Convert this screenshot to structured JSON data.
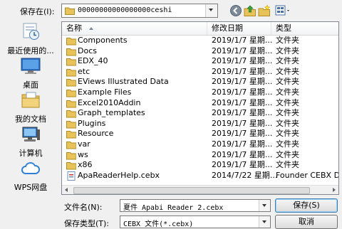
{
  "location": {
    "label": "保存在(I):",
    "path": "00000000000000000ceshi"
  },
  "toolbar": {
    "back_icon": "back-arrow-icon",
    "up_icon": "up-folder-icon",
    "new_folder_icon": "new-folder-icon",
    "views_icon": "view-menu-icon"
  },
  "places": [
    {
      "label": "最近使用的...",
      "icon": "recent-icon"
    },
    {
      "label": "桌面",
      "icon": "desktop-icon"
    },
    {
      "label": "我的文档",
      "icon": "documents-icon"
    },
    {
      "label": "计算机",
      "icon": "computer-icon"
    },
    {
      "label": "WPS网盘",
      "icon": "cloud-icon"
    }
  ],
  "columns": {
    "name": "名称",
    "date": "修改日期",
    "type": "类型"
  },
  "files": [
    {
      "name": "Components",
      "date": "2019/1/7 星期...",
      "type": "文件夹",
      "icon": "folder-icon"
    },
    {
      "name": "Docs",
      "date": "2019/1/7 星期...",
      "type": "文件夹",
      "icon": "folder-icon"
    },
    {
      "name": "EDX_40",
      "date": "2019/1/7 星期...",
      "type": "文件夹",
      "icon": "folder-icon"
    },
    {
      "name": "etc",
      "date": "2019/1/7 星期...",
      "type": "文件夹",
      "icon": "folder-icon"
    },
    {
      "name": "EViews Illustrated Data",
      "date": "2019/1/7 星期...",
      "type": "文件夹",
      "icon": "folder-icon"
    },
    {
      "name": "Example Files",
      "date": "2019/1/7 星期...",
      "type": "文件夹",
      "icon": "folder-icon"
    },
    {
      "name": "Excel2010Addin",
      "date": "2019/1/7 星期...",
      "type": "文件夹",
      "icon": "folder-icon"
    },
    {
      "name": "Graph_templates",
      "date": "2019/1/7 星期...",
      "type": "文件夹",
      "icon": "folder-icon"
    },
    {
      "name": "Plugins",
      "date": "2019/1/7 星期...",
      "type": "文件夹",
      "icon": "folder-icon"
    },
    {
      "name": "Resource",
      "date": "2019/1/7 星期...",
      "type": "文件夹",
      "icon": "folder-icon"
    },
    {
      "name": "var",
      "date": "2019/1/7 星期...",
      "type": "文件夹",
      "icon": "folder-icon"
    },
    {
      "name": "ws",
      "date": "2019/1/7 星期...",
      "type": "文件夹",
      "icon": "folder-icon"
    },
    {
      "name": "x86",
      "date": "2019/1/7 星期...",
      "type": "文件夹",
      "icon": "folder-icon"
    },
    {
      "name": "ApaReaderHelp.cebx",
      "date": "2014/7/22 星期...",
      "type": "Founder CEBX D...",
      "icon": "cebx-file-icon"
    }
  ],
  "filename": {
    "label": "文件名(N):",
    "value": "夏件 Apabi Reader 2.cebx"
  },
  "filetype": {
    "label": "保存类型(T):",
    "value": "CEBX 文件(*.cebx)"
  },
  "buttons": {
    "save": "保存(S)",
    "cancel": "取消"
  },
  "colors": {
    "folder": "#e8c35a",
    "accent": "#3c7fb1"
  }
}
